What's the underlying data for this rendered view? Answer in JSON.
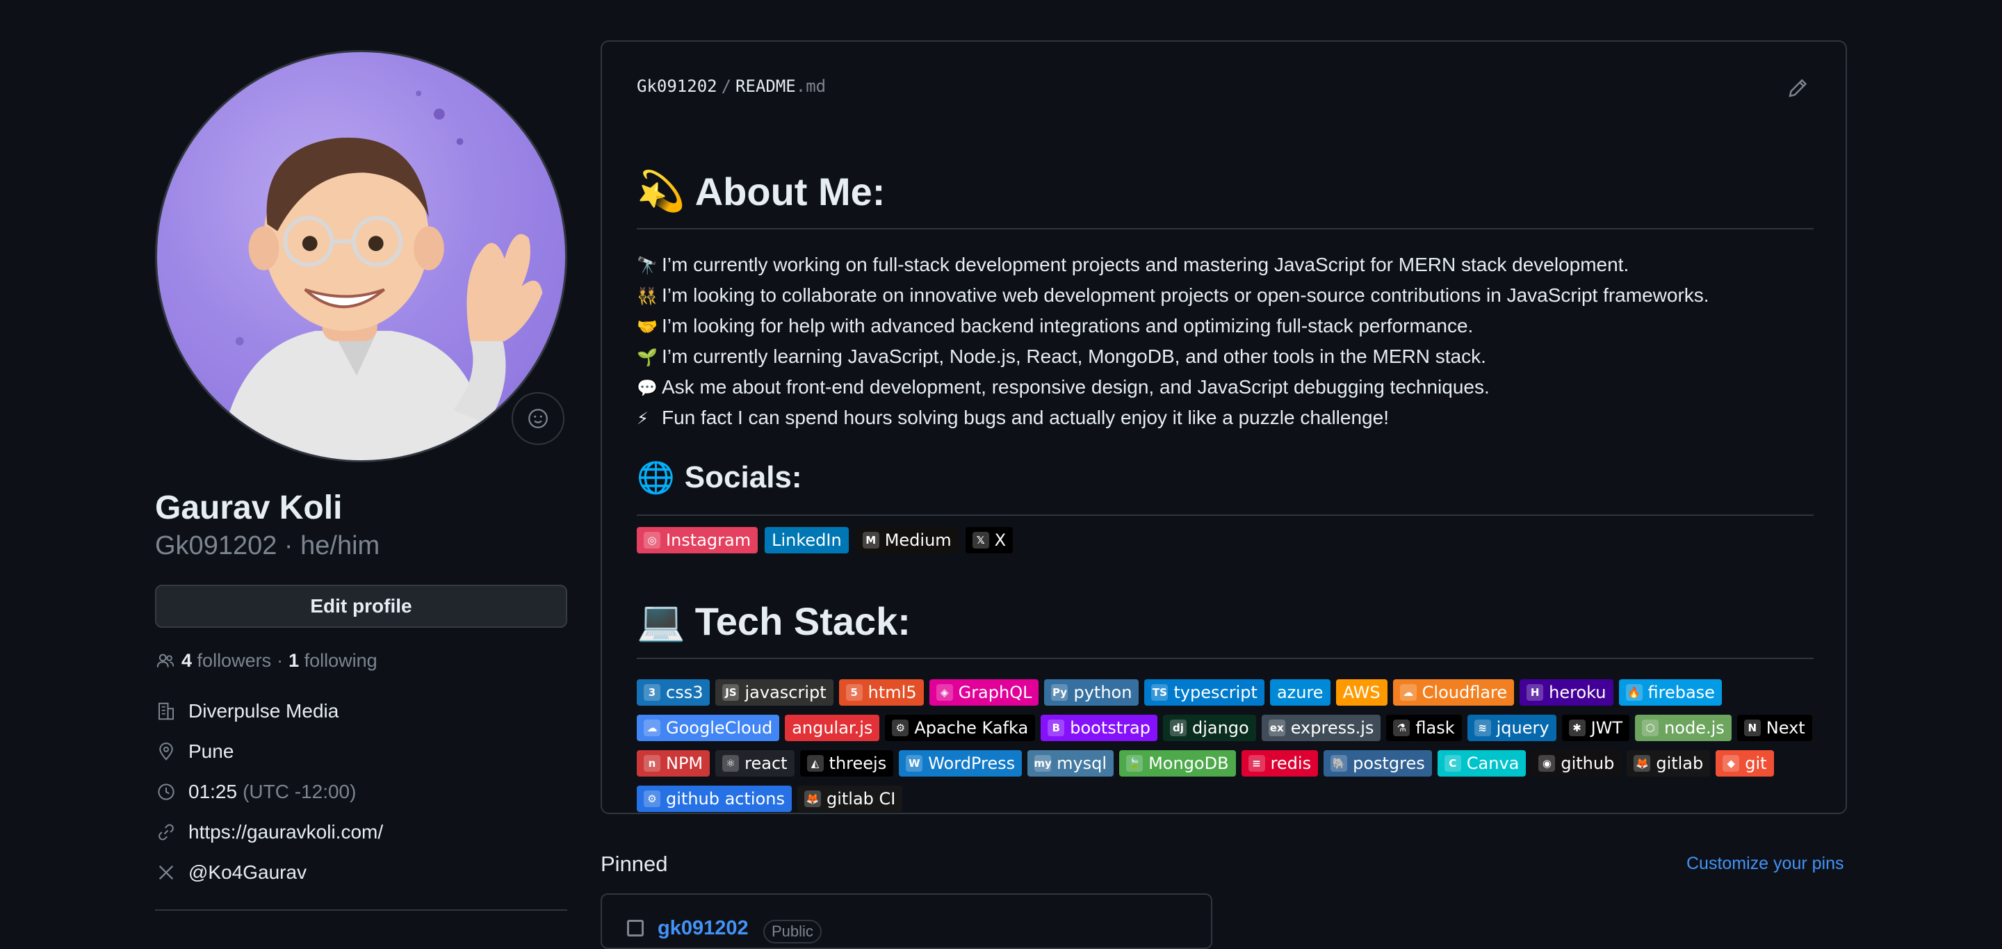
{
  "profile": {
    "name": "Gaurav Koli",
    "username": "Gk091202",
    "pronouns": "he/him",
    "username_line": "Gk091202 · he/him",
    "edit_label": "Edit profile",
    "followers_count": "4",
    "followers_label": "followers",
    "separator": "·",
    "following_count": "1",
    "following_label": "following",
    "details": {
      "company": "Diverpulse Media",
      "location": "Pune",
      "time": "01:25",
      "timezone": "(UTC -12:00)",
      "website": "https://gauravkoli.com/",
      "twitter": "@Ko4Gaurav"
    }
  },
  "readme": {
    "owner": "Gk091202",
    "sep": "/",
    "file": "README",
    "ext": ".md",
    "about_emoji": "💫",
    "about_title": "About Me:",
    "about_lines": [
      {
        "emoji": "🔭",
        "text": "I’m currently working on full-stack development projects and mastering JavaScript for MERN stack development."
      },
      {
        "emoji": "👯",
        "text": "I’m looking to collaborate on innovative web development projects or open-source contributions in JavaScript frameworks."
      },
      {
        "emoji": "🤝",
        "text": "I’m looking for help with advanced backend integrations and optimizing full-stack performance."
      },
      {
        "emoji": "🌱",
        "text": "I’m currently learning JavaScript, Node.js, React, MongoDB, and other tools in the MERN stack."
      },
      {
        "emoji": "💬",
        "text": "Ask me about front-end development, responsive design, and JavaScript debugging techniques."
      },
      {
        "emoji": "⚡",
        "text": "Fun fact I can spend hours solving bugs and actually enjoy it like a puzzle challenge!"
      }
    ],
    "socials_emoji": "🌐",
    "socials_title": "Socials:",
    "socials": [
      {
        "label": "Instagram",
        "color": "#e4405f",
        "icon": "instagram-icon",
        "glyph": "◎"
      },
      {
        "label": "LinkedIn",
        "color": "#0077b5",
        "icon": "linkedin-icon",
        "glyph": ""
      },
      {
        "label": "Medium",
        "color": "#12100e",
        "icon": "medium-icon",
        "glyph": "M"
      },
      {
        "label": "X",
        "color": "#000000",
        "icon": "x-icon",
        "glyph": "𝕏"
      }
    ],
    "tech_emoji": "💻",
    "tech_title": "Tech Stack:",
    "tech_rows": [
      [
        {
          "label": "css3",
          "color": "#1572b6",
          "icon": "css3-icon",
          "glyph": "3"
        },
        {
          "label": "javascript",
          "color": "#323330",
          "icon": "javascript-icon",
          "glyph": "JS"
        },
        {
          "label": "html5",
          "color": "#e34f26",
          "icon": "html5-icon",
          "glyph": "5"
        },
        {
          "label": "GraphQL",
          "color": "#e10098",
          "icon": "graphql-icon",
          "glyph": "◈"
        },
        {
          "label": "python",
          "color": "#3670a0",
          "icon": "python-icon",
          "glyph": "Py"
        },
        {
          "label": "typescript",
          "color": "#007acc",
          "icon": "typescript-icon",
          "glyph": "TS"
        },
        {
          "label": "azure",
          "color": "#0089d6",
          "icon": "azure-icon",
          "glyph": ""
        },
        {
          "label": "AWS",
          "color": "#ff9900",
          "icon": "aws-icon",
          "glyph": ""
        },
        {
          "label": "Cloudflare",
          "color": "#f38020",
          "icon": "cloudflare-icon",
          "glyph": "☁"
        },
        {
          "label": "heroku",
          "color": "#430098",
          "icon": "heroku-icon",
          "glyph": "H"
        },
        {
          "label": "firebase",
          "color": "#039be5",
          "icon": "firebase-icon",
          "glyph": "🔥"
        }
      ],
      [
        {
          "label": "GoogleCloud",
          "color": "#4285f4",
          "icon": "googlecloud-icon",
          "glyph": "☁"
        },
        {
          "label": "angular.js",
          "color": "#e23237",
          "icon": "angular-icon",
          "glyph": ""
        },
        {
          "label": "Apache Kafka",
          "color": "#000000",
          "icon": "kafka-icon",
          "glyph": "⚙"
        },
        {
          "label": "bootstrap",
          "color": "#8511fa",
          "icon": "bootstrap-icon",
          "glyph": "B"
        },
        {
          "label": "django",
          "color": "#092e20",
          "icon": "django-icon",
          "glyph": "dj"
        },
        {
          "label": "express.js",
          "color": "#404d59",
          "icon": "express-icon",
          "glyph": "ex"
        },
        {
          "label": "flask",
          "color": "#000000",
          "icon": "flask-icon",
          "glyph": "⚗"
        },
        {
          "label": "jquery",
          "color": "#0769ad",
          "icon": "jquery-icon",
          "glyph": "≋"
        },
        {
          "label": "JWT",
          "color": "#000000",
          "icon": "jwt-icon",
          "glyph": "✱"
        },
        {
          "label": "node.js",
          "color": "#6da55f",
          "icon": "nodejs-icon",
          "glyph": "⬡"
        },
        {
          "label": "Next",
          "color": "#000000",
          "icon": "nextjs-icon",
          "glyph": "N"
        }
      ],
      [
        {
          "label": "NPM",
          "color": "#cb3837",
          "icon": "npm-icon",
          "glyph": "n"
        },
        {
          "label": "react",
          "color": "#20232a",
          "icon": "react-icon",
          "glyph": "⚛"
        },
        {
          "label": "threejs",
          "color": "#000000",
          "icon": "threejs-icon",
          "glyph": "◭"
        },
        {
          "label": "WordPress",
          "color": "#117ac9",
          "icon": "wordpress-icon",
          "glyph": "W"
        },
        {
          "label": "mysql",
          "color": "#4479a1",
          "icon": "mysql-icon",
          "glyph": "my"
        },
        {
          "label": "MongoDB",
          "color": "#4ea94b",
          "icon": "mongodb-icon",
          "glyph": "🍃"
        },
        {
          "label": "redis",
          "color": "#dd0031",
          "icon": "redis-icon",
          "glyph": "≡"
        },
        {
          "label": "postgres",
          "color": "#316192",
          "icon": "postgres-icon",
          "glyph": "🐘"
        },
        {
          "label": "Canva",
          "color": "#00c4cc",
          "icon": "canva-icon",
          "glyph": "C"
        },
        {
          "label": "github",
          "color": "#121011",
          "icon": "github-icon",
          "glyph": "◉"
        },
        {
          "label": "gitlab",
          "color": "#181717",
          "icon": "gitlab-icon",
          "glyph": "🦊"
        },
        {
          "label": "git",
          "color": "#f05033",
          "icon": "git-icon",
          "glyph": "◆"
        }
      ],
      [
        {
          "label": "github actions",
          "color": "#2671e5",
          "icon": "github-actions-icon",
          "glyph": "⚙"
        },
        {
          "label": "gitlab CI",
          "color": "#181717",
          "icon": "gitlab-ci-icon",
          "glyph": "🦊"
        }
      ]
    ]
  },
  "pinned": {
    "title": "Pinned",
    "customize_label": "Customize your pins",
    "repo_name": "gk091202",
    "visibility": "Public"
  }
}
